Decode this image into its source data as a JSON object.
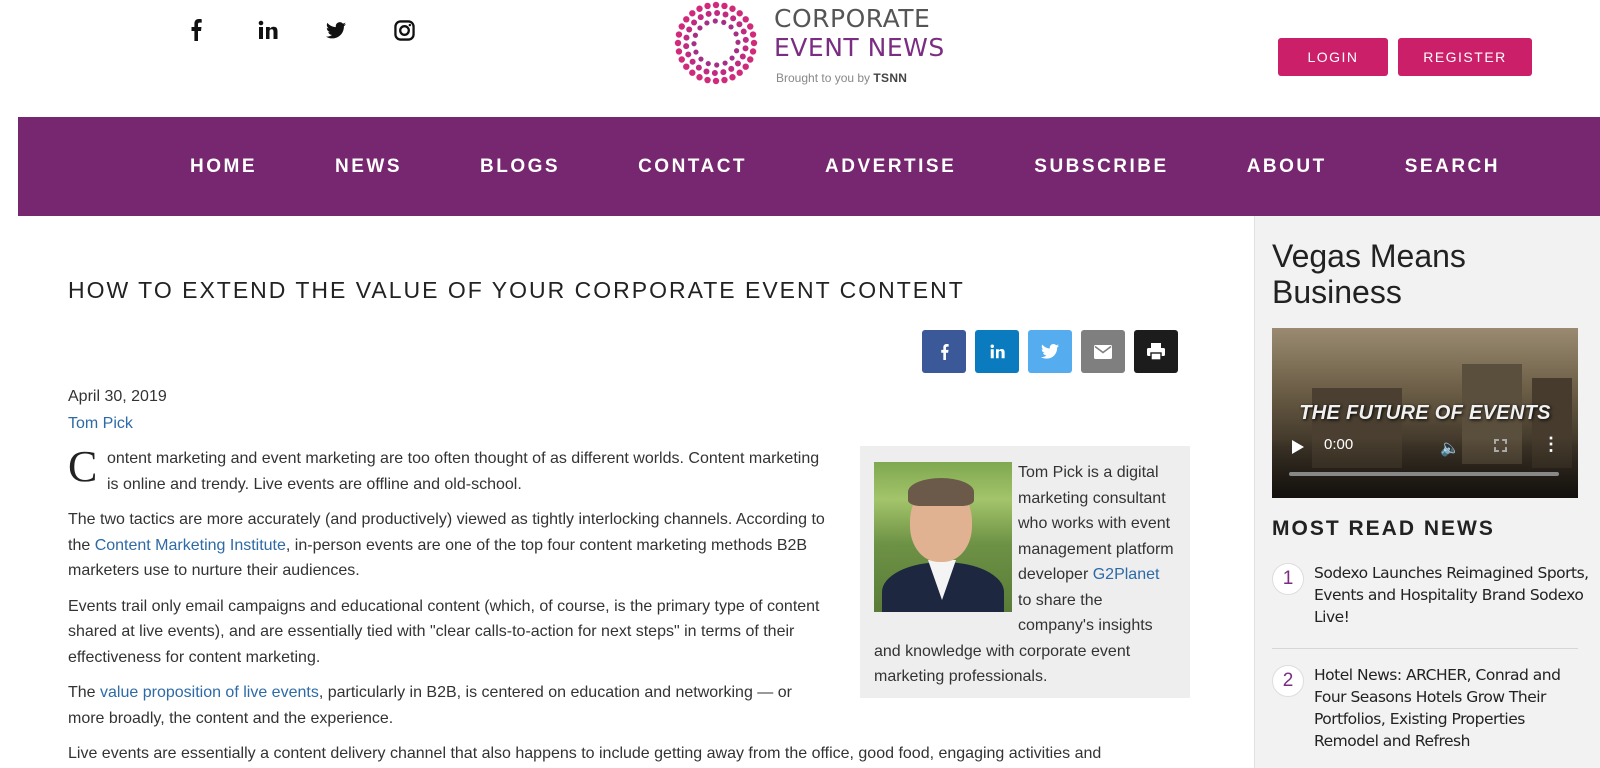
{
  "header": {
    "social": [
      {
        "icon": "facebook-icon",
        "glyph": "f"
      },
      {
        "icon": "linkedin-icon",
        "glyph": "in"
      },
      {
        "icon": "twitter-icon",
        "glyph": ""
      },
      {
        "icon": "instagram-icon",
        "glyph": ""
      }
    ],
    "logo": {
      "line1": "CORPORATE",
      "line2": "EVENT NEWS",
      "brought_by": "Brought to you by",
      "brought_brand": "TSNN"
    },
    "login_label": "LOGIN",
    "register_label": "REGISTER"
  },
  "nav": {
    "items": [
      "HOME",
      "NEWS",
      "BLOGS",
      "CONTACT",
      "ADVERTISE",
      "SUBSCRIBE",
      "ABOUT",
      "SEARCH"
    ]
  },
  "article": {
    "title": "HOW TO EXTEND THE VALUE OF YOUR CORPORATE EVENT CONTENT",
    "share": [
      {
        "icon": "facebook-share-icon",
        "glyph": "f"
      },
      {
        "icon": "linkedin-share-icon",
        "glyph": "in"
      },
      {
        "icon": "twitter-share-icon",
        "glyph": ""
      },
      {
        "icon": "email-share-icon",
        "glyph": ""
      },
      {
        "icon": "print-icon",
        "glyph": ""
      }
    ],
    "date": "April 30, 2019",
    "author": "Tom Pick",
    "p1_dropcap": "C",
    "p1_rest": "ontent marketing and event marketing are too often thought of as different worlds. Content marketing is online and trendy. Live events are offline and old-school.",
    "p2_before": "The two tactics are more accurately (and productively) viewed as tightly interlocking channels. According to the ",
    "p2_link": "Content Marketing Institute",
    "p2_after": ", in-person events are one of the top four content marketing methods B2B marketers use to nurture their audiences.",
    "p3": "Events trail only email campaigns and educational content (which, of course, is the primary type of content shared at live events), and are essentially tied with \"clear calls-to-action for next steps\" in terms of their effectiveness for content marketing.",
    "p4_before": "The ",
    "p4_link": "value proposition of live events",
    "p4_after": ", particularly in B2B, is centered on education and networking — or more broadly, the content and the experience.",
    "p5": "Live events are essentially a content delivery channel that also happens to include getting away from the office, good food, engaging activities and",
    "bio": {
      "before": "Tom Pick is a digital marketing consultant who works with event management platform developer ",
      "link": "G2Planet",
      "after": " to share the company's insights and knowledge with corporate event marketing professionals."
    }
  },
  "sidebar": {
    "promo_title": "Vegas Means Business",
    "video": {
      "caption": "THE FUTURE OF EVENTS",
      "time": "0:00"
    },
    "most_read_title": "MOST READ NEWS",
    "most_read": [
      {
        "num": "1",
        "text": "Sodexo Launches Reimagined Sports, Events and Hospitality Brand Sodexo Live!"
      },
      {
        "num": "2",
        "text": "Hotel News: ARCHER, Conrad and Four Seasons Hotels Grow Their Portfolios, Existing Properties Remodel and Refresh"
      }
    ]
  },
  "colors": {
    "nav_bg": "#77276f",
    "button_accent": "#cc1f6a",
    "link": "#2d6aa6"
  }
}
